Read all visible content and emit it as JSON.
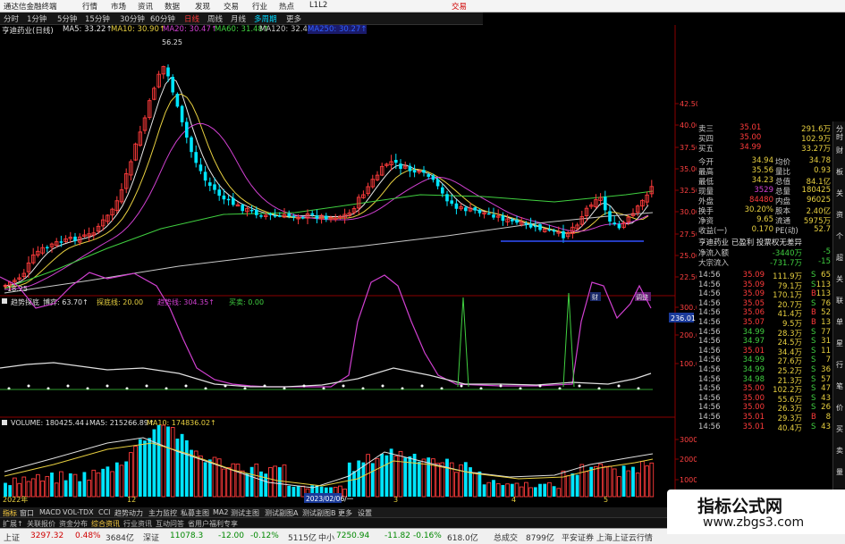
{
  "titlebar": {
    "app_name": "通达信金融终端",
    "menus": [
      "行情",
      "市场",
      "资讯",
      "数据",
      "发现",
      "交易",
      "行业",
      "热点",
      "L1L2"
    ],
    "trade_label": "交易",
    "colors": {
      "active": "#d00000"
    }
  },
  "periodbar": {
    "periods": [
      "分时",
      "1分钟",
      "5分钟",
      "15分钟",
      "30分钟",
      "60分钟",
      "日线",
      "周线",
      "月线",
      "多周期",
      "更多"
    ],
    "active": "日线"
  },
  "kline": {
    "stock_label": "亨迪药业(日线)",
    "ma_labels": [
      "MA5: 33.22↑",
      "MA10: 30.90↑",
      "MA20: 30.47↑",
      "MA60: 31.48↑",
      "MA120: 32.40↑",
      "MA250: 30.27↑"
    ],
    "high_label": "56.25",
    "low_label": "18.25",
    "price_ticks": [
      "42.50",
      "40.00",
      "37.50",
      "35.00",
      "32.50",
      "30.00",
      "27.50",
      "25.00",
      "22.50"
    ],
    "markers": [
      "财",
      "调整"
    ]
  },
  "indicator": {
    "labels": [
      "趋势探底",
      "博弈: 63.70↑",
      "探底线: 20.00",
      "趋势线: 304.35↑",
      "买卖: 0.00"
    ],
    "ticks": [
      "300.0",
      "200.0",
      "100.0"
    ],
    "current_value": "236.01"
  },
  "volume": {
    "labels": [
      "VOLUME: 180425.44↓",
      "MA5: 215266.89↑",
      "MA10: 174836.02↑"
    ],
    "ticks": [
      "30000",
      "20000",
      "10000"
    ],
    "date_axis": [
      "2022年",
      "12",
      "2023/02/06/一",
      "3",
      "4",
      "5",
      "6"
    ],
    "tail_label": "万"
  },
  "tabs": [
    "指标",
    "窗口",
    "MACD",
    "VOL-TDX",
    "CCI",
    "趋势动力",
    "主力监控",
    "私募主图",
    "MA2",
    "测试主图",
    "测试副图A",
    "测试副图B",
    "更多",
    "设置",
    "模板"
  ],
  "tabs2": [
    "扩展↑",
    "关联报价",
    "资金分布",
    "综合资讯",
    "行业资讯",
    "互动问答",
    "省用户福利专享"
  ],
  "quote": {
    "order_book": [
      [
        "卖三",
        "35.01",
        "291.6万"
      ],
      [
        "买四",
        "35.00",
        "102.9万"
      ],
      [
        "买五",
        "34.99",
        "33.27万"
      ]
    ],
    "stats": [
      [
        "今开",
        "34.94",
        "均价",
        "34.78"
      ],
      [
        "最高",
        "35.56",
        "量比",
        "0.93"
      ],
      [
        "最低",
        "34.23",
        "总值",
        "84.1亿"
      ],
      [
        "现量",
        "3529",
        "总量",
        "180425"
      ],
      [
        "外盘",
        "84480",
        "内盘",
        "96025"
      ],
      [
        "换手",
        "30.20%",
        "股本",
        "2.40亿"
      ],
      [
        "净资",
        "9.65",
        "流通",
        "5975万"
      ],
      [
        "收益(一)",
        "0.170",
        "PE(动)",
        "52.7"
      ]
    ],
    "stock_info": "亨迪药业 已盈利 投票权无差异",
    "flows": [
      [
        "净流入额",
        "-3440万",
        "-5"
      ],
      [
        "大宗流入",
        "-731.7万",
        "-15"
      ]
    ],
    "ticks": [
      [
        "14:56",
        "35.09",
        "111.9万",
        "S",
        "65"
      ],
      [
        "14:56",
        "35.09",
        "79.1万",
        "S",
        "113"
      ],
      [
        "14:56",
        "35.09",
        "170.1万",
        "B",
        "113"
      ],
      [
        "14:56",
        "35.05",
        "20.7万",
        "S",
        "76"
      ],
      [
        "14:56",
        "35.06",
        "41.4万",
        "B",
        "52"
      ],
      [
        "14:56",
        "35.07",
        "9.5万",
        "B",
        "13"
      ],
      [
        "14:56",
        "34.99",
        "28.3万",
        "S",
        "77"
      ],
      [
        "14:56",
        "34.97",
        "24.5万",
        "S",
        "31"
      ],
      [
        "14:56",
        "35.01",
        "34.4万",
        "S",
        "11"
      ],
      [
        "14:56",
        "34.99",
        "27.6万",
        "S",
        "7"
      ],
      [
        "14:56",
        "34.99",
        "25.2万",
        "S",
        "36"
      ],
      [
        "14:56",
        "34.98",
        "21.3万",
        "S",
        "57"
      ],
      [
        "14:56",
        "35.00",
        "102.2万",
        "S",
        "47"
      ],
      [
        "14:56",
        "35.00",
        "55.6万",
        "S",
        "43"
      ],
      [
        "14:56",
        "35.00",
        "26.3万",
        "S",
        "26"
      ],
      [
        "14:56",
        "35.01",
        "29.3万",
        "B",
        "8"
      ],
      [
        "14:56",
        "35.01",
        "40.4万",
        "S",
        "43"
      ]
    ]
  },
  "right_tabs": [
    "分时",
    "财",
    "板",
    "关",
    "资",
    "个",
    "超",
    "关",
    "联",
    "单",
    "星",
    "行",
    "笔",
    "价",
    "买",
    "卖",
    "量",
    "所"
  ],
  "statusbar": [
    {
      "text": "上证",
      "color": "#333"
    },
    {
      "text": "3297.32",
      "color": "#d00000"
    },
    {
      "text": "0.48%",
      "color": "#d00000"
    },
    {
      "text": "3684亿",
      "color": "#333"
    },
    {
      "text": "深证",
      "color": "#333"
    },
    {
      "text": "11078.3",
      "color": "#008800"
    },
    {
      "text": "-12.00",
      "color": "#008800"
    },
    {
      "text": "-0.12%",
      "color": "#008800"
    },
    {
      "text": "5115亿",
      "color": "#333"
    },
    {
      "text": "中小",
      "color": "#333"
    },
    {
      "text": "7250.94",
      "color": "#008800"
    },
    {
      "text": "-11.82",
      "color": "#008800"
    },
    {
      "text": "-0.16%",
      "color": "#008800"
    },
    {
      "text": "618.0亿",
      "color": "#333"
    },
    {
      "text": "总成交",
      "color": "#333"
    },
    {
      "text": "8799亿",
      "color": "#333"
    },
    {
      "text": "平安证券 上海上证云行情",
      "color": "#333"
    }
  ],
  "watermark": {
    "title": "指标公式网",
    "url": "www.zbgs3.com"
  },
  "colors": {
    "up": "#ff3b3b",
    "down": "#00e5ff",
    "bg": "#000000"
  }
}
